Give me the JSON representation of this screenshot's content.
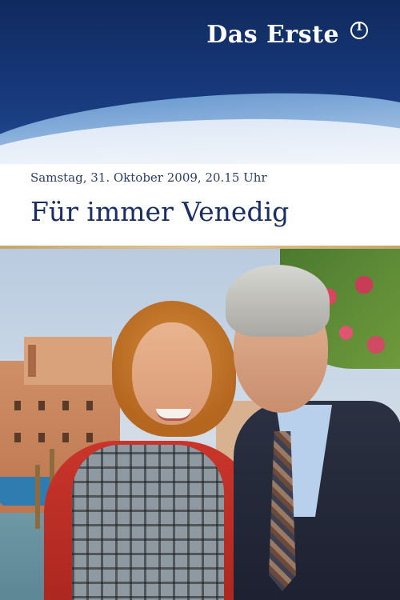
{
  "header": {
    "brand_text": "Das Erste",
    "brand_icon": "ard-one-logo-icon",
    "brand_color": "#ffffff",
    "background_color": "#163676"
  },
  "title_panel": {
    "airdate": "Samstag, 31. Oktober 2009, 20.15 Uhr",
    "title": "Für immer Venedig",
    "text_color": "#1a2e66"
  }
}
